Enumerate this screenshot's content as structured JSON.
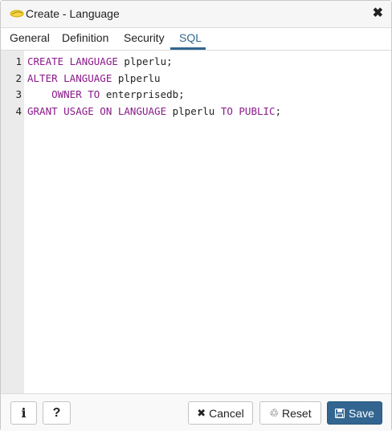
{
  "dialog": {
    "title": "Create - Language",
    "close_icon": "✖",
    "title_icon": "language-icon"
  },
  "tabs": [
    {
      "label": "General",
      "active": false
    },
    {
      "label": "Definition",
      "active": false
    },
    {
      "label": "Security",
      "active": false
    },
    {
      "label": "SQL",
      "active": true
    }
  ],
  "editor": {
    "lines": [
      {
        "num": "1",
        "segments": [
          {
            "t": "CREATE LANGUAGE",
            "kw": true
          },
          {
            "t": " plperlu;",
            "kw": false
          }
        ]
      },
      {
        "num": "2",
        "segments": [
          {
            "t": "ALTER LANGUAGE",
            "kw": true
          },
          {
            "t": " plperlu",
            "kw": false
          }
        ]
      },
      {
        "num": "3",
        "segments": [
          {
            "t": "    ",
            "kw": false
          },
          {
            "t": "OWNER TO",
            "kw": true
          },
          {
            "t": " enterprisedb;",
            "kw": false
          }
        ]
      },
      {
        "num": "4",
        "segments": [
          {
            "t": "GRANT USAGE ON LANGUAGE",
            "kw": true
          },
          {
            "t": " plperlu ",
            "kw": false
          },
          {
            "t": "TO PUBLIC",
            "kw": true
          },
          {
            "t": ";",
            "kw": false
          }
        ]
      }
    ],
    "keyword_color": "#8a1a8a"
  },
  "footer": {
    "info_label": "i",
    "help_label": "?",
    "cancel_label": "Cancel",
    "cancel_icon": "✖",
    "reset_label": "Reset",
    "reset_icon": "♲",
    "save_label": "Save",
    "save_icon": "💾"
  },
  "colors": {
    "accent": "#326690"
  }
}
